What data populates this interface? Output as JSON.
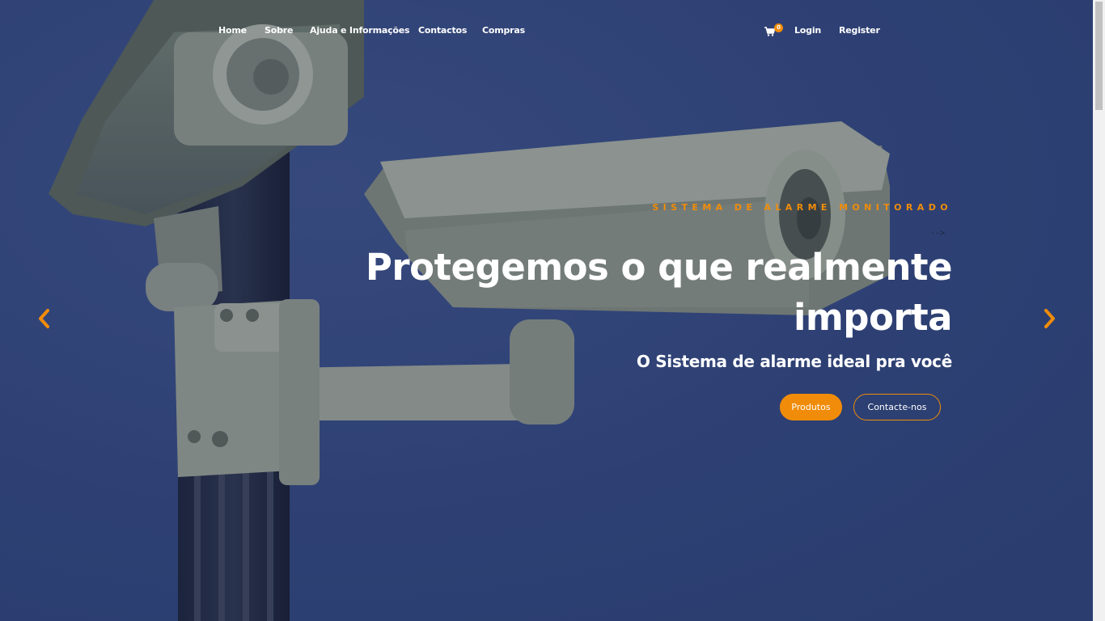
{
  "nav": {
    "links": [
      "Home",
      "Sobre",
      "Ajuda e Informações",
      "Contactos",
      "Compras"
    ],
    "cart_count": "0",
    "login": "Login",
    "register": "Register"
  },
  "hero": {
    "eyebrow": "SISTEMA DE ALARME MONITORADO",
    "arrow": "-->",
    "headline_line1": "Protegemos o que realmente",
    "headline_line2": "importa",
    "subheadline": "O Sistema de alarme ideal pra você",
    "primary_button": "Produtos",
    "secondary_button": "Contacte-nos"
  },
  "icons": {
    "cart": "shopping-cart-icon",
    "prev": "chevron-left-icon",
    "next": "chevron-right-icon"
  },
  "colors": {
    "accent": "#f08c0a",
    "background": "#33467a",
    "text": "#ffffff"
  }
}
